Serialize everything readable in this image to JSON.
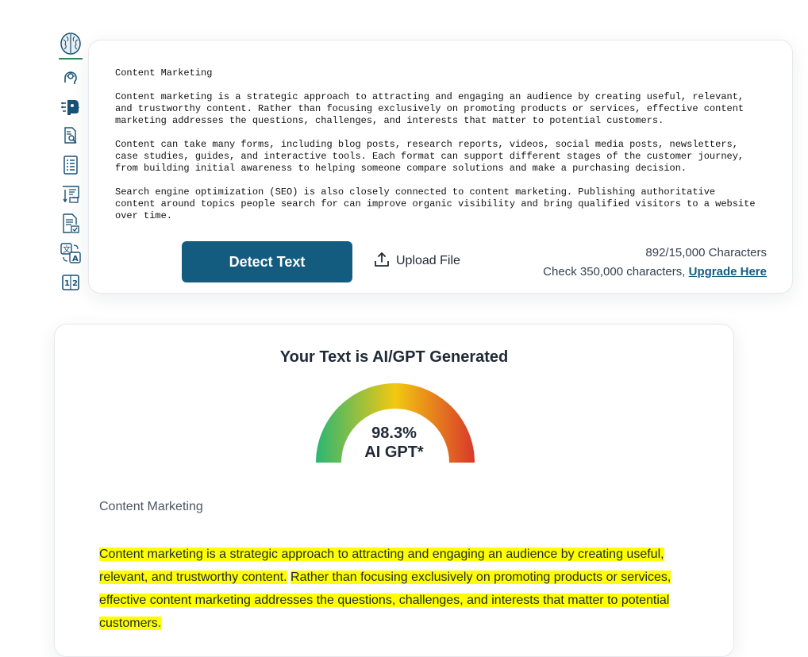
{
  "rail": {
    "items": [
      {
        "icon": "ai-head-icon"
      },
      {
        "icon": "robot-head-icon"
      },
      {
        "icon": "document-search-icon"
      },
      {
        "icon": "document-list-icon"
      },
      {
        "icon": "sort-list-icon"
      },
      {
        "icon": "document-check-icon"
      },
      {
        "icon": "translate-icon"
      },
      {
        "icon": "numbers-icon"
      }
    ]
  },
  "editor": {
    "text": "Content Marketing\n\nContent marketing is a strategic approach to attracting and engaging an audience by creating useful, relevant,\nand trustworthy content. Rather than focusing exclusively on promoting products or services, effective content\nmarketing addresses the questions, challenges, and interests that matter to potential customers.\n\nContent can take many forms, including blog posts, research reports, videos, social media posts, newsletters,\ncase studies, guides, and interactive tools. Each format can support different stages of the customer journey,\nfrom building initial awareness to helping someone compare solutions and make a purchasing decision.\n\nSearch engine optimization (SEO) is also closely connected to content marketing. Publishing authoritative\ncontent around topics people search for can improve organic visibility and bring qualified visitors to a website\nover time.",
    "detect_label": "Detect Text",
    "upload_label": "Upload File",
    "char_count": "892/15,000 Characters",
    "check_prefix": "Check 350,000 characters,",
    "upgrade_label": "Upgrade Here"
  },
  "result": {
    "title": "Your Text is AI/GPT Generated",
    "score_value": 98.3,
    "score_text": "98.3%",
    "score_label": "AI GPT*",
    "heading": "Content Marketing",
    "sentences": [
      {
        "text": "Content marketing is a strategic approach to attracting and engaging an audience by creating useful, relevant, and trustworthy content.",
        "highlighted": true
      },
      {
        "text": "Rather than focusing exclusively on promoting products or services, effective content marketing addresses the questions, challenges, and interests that matter to potential customers.",
        "highlighted": true
      }
    ]
  },
  "colors": {
    "primary": "#135c80",
    "highlight": "#ffff00",
    "gauge_low": "#2bb673",
    "gauge_mid": "#f2c811",
    "gauge_high": "#d9382b"
  }
}
